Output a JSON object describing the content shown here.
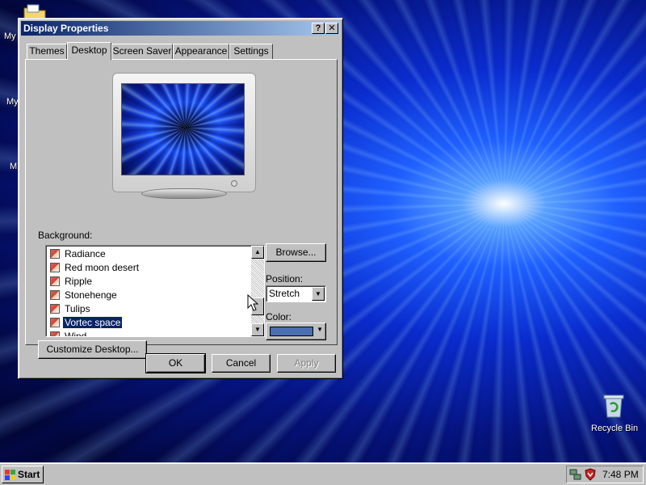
{
  "desktop": {
    "icons": [
      {
        "label": "My"
      },
      {
        "label": "My"
      },
      {
        "label": "M"
      },
      {
        "label": "Recycle Bin"
      }
    ]
  },
  "window": {
    "title": "Display Properties",
    "help_glyph": "?",
    "close_glyph": "✕",
    "tabs": [
      {
        "label": "Themes"
      },
      {
        "label": "Desktop"
      },
      {
        "label": "Screen Saver"
      },
      {
        "label": "Appearance"
      },
      {
        "label": "Settings"
      }
    ],
    "active_tab": "Desktop",
    "background_label": "Background:",
    "background_list": [
      {
        "label": "Radiance"
      },
      {
        "label": "Red moon desert"
      },
      {
        "label": "Ripple"
      },
      {
        "label": "Stonehenge"
      },
      {
        "label": "Tulips"
      },
      {
        "label": "Vortec space"
      },
      {
        "label": "Wind"
      }
    ],
    "selected_background": "Vortec space",
    "browse_label": "Browse...",
    "position_label": "Position:",
    "position_value": "Stretch",
    "color_label": "Color:",
    "color_value": "#4a6fb0",
    "customize_label": "Customize Desktop...",
    "ok_label": "OK",
    "cancel_label": "Cancel",
    "apply_label": "Apply"
  },
  "taskbar": {
    "start_label": "Start",
    "clock": "7:48 PM"
  },
  "colors": {
    "title_active": "#0a246a",
    "face": "#c0c0c0",
    "selection": "#0a246a"
  }
}
